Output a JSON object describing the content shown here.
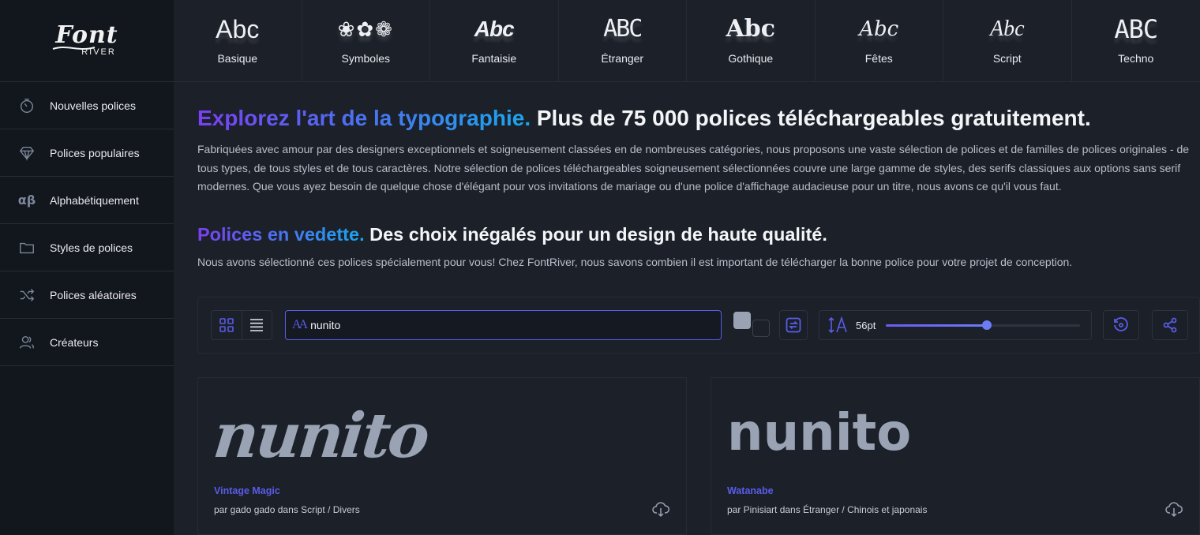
{
  "logo": {
    "top": "Font",
    "bottom": "RIVER"
  },
  "categories": [
    {
      "sample": "Abc",
      "label": "Basique",
      "cls": "s-basic"
    },
    {
      "sample": "❀✿❁",
      "label": "Symboles",
      "cls": "s-sym"
    },
    {
      "sample": "Abc",
      "label": "Fantaisie",
      "cls": "s-fant"
    },
    {
      "sample": "ABC",
      "label": "Étranger",
      "cls": "s-foreign"
    },
    {
      "sample": "Abc",
      "label": "Gothique",
      "cls": "s-goth"
    },
    {
      "sample": "Abc",
      "label": "Fêtes",
      "cls": "s-fete"
    },
    {
      "sample": "Abc",
      "label": "Script",
      "cls": "s-script"
    },
    {
      "sample": "ABC",
      "label": "Techno",
      "cls": "s-techno"
    }
  ],
  "sidebar": {
    "items": [
      {
        "label": "Nouvelles polices",
        "icon": "clock-icon"
      },
      {
        "label": "Polices populaires",
        "icon": "diamond-icon"
      },
      {
        "label": "Alphabétiquement",
        "icon": "alpha-beta-icon"
      },
      {
        "label": "Styles de polices",
        "icon": "folder-icon"
      },
      {
        "label": "Polices aléatoires",
        "icon": "shuffle-icon"
      },
      {
        "label": "Créateurs",
        "icon": "users-icon"
      }
    ]
  },
  "hero": {
    "title_accent": "Explorez l'art de la typographie.",
    "title_rest": " Plus de 75 000 polices téléchargeables gratuitement.",
    "body": "Fabriquées avec amour par des designers exceptionnels et soigneusement classées en de nombreuses catégories, nous proposons une vaste sélection de polices et de familles de polices originales - de tous types, de tous styles et de tous caractères. Notre sélection de polices téléchargeables soigneusement sélectionnées couvre une large gamme de styles, des serifs classiques aux options sans serif modernes. Que vous ayez besoin de quelque chose d'élégant pour vos invitations de mariage ou d'une police d'affichage audacieuse pour un titre, nous avons ce qu'il vous faut."
  },
  "featured": {
    "title_accent": "Polices en vedette.",
    "title_rest": " Des choix inégalés pour un design de haute qualité.",
    "body": "Nous avons sélectionné ces polices spécialement pour vous! Chez FontRiver, nous savons combien il est important de télécharger la bonne police pour votre projet de conception."
  },
  "toolbar": {
    "search_value": "nunito",
    "size_label": "56pt",
    "size_fraction": 0.52,
    "fg_color": "#9aa3b3",
    "bg_color": "#1b2029",
    "accent": "#5a5ce8"
  },
  "cards": [
    {
      "preview": "nunito",
      "name": "Vintage Magic",
      "meta": "par gado gado dans Script / Divers"
    },
    {
      "preview": "nunito",
      "name": "Watanabe",
      "meta": "par Pinisiart dans Étranger / Chinois et japonais"
    }
  ]
}
